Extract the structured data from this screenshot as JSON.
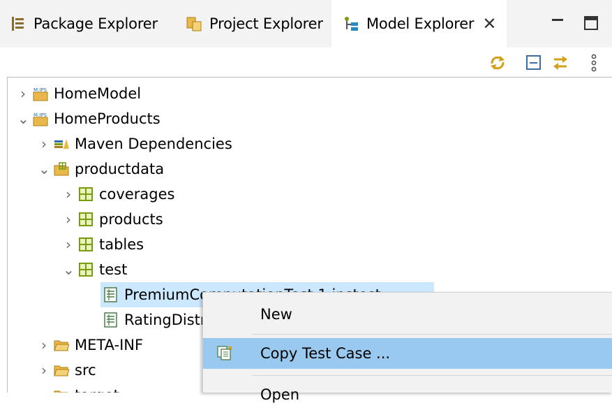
{
  "tabs": [
    {
      "label": "Package Explorer",
      "icon": "package-explorer-icon"
    },
    {
      "label": "Project Explorer",
      "icon": "project-explorer-icon"
    },
    {
      "label": "Model Explorer",
      "icon": "model-explorer-icon",
      "active": true,
      "close": "✕"
    }
  ],
  "window_controls": {
    "minimize": "minimize-icon",
    "maximize": "maximize-icon"
  },
  "toolbar_icons": [
    "sync-icon",
    "collapse-all-icon",
    "link-with-editor-icon",
    "view-menu-icon"
  ],
  "tree": [
    {
      "label": "HomeModel",
      "expanded": false,
      "icon": "model-project-icon"
    },
    {
      "label": "HomeProducts",
      "expanded": true,
      "icon": "model-project-icon"
    },
    {
      "label": "Maven Dependencies",
      "expanded": false,
      "icon": "library-icon"
    },
    {
      "label": "productdata",
      "expanded": true,
      "icon": "source-folder-icon"
    },
    {
      "label": "coverages",
      "expanded": false,
      "icon": "package-icon"
    },
    {
      "label": "products",
      "expanded": false,
      "icon": "package-icon"
    },
    {
      "label": "tables",
      "expanded": false,
      "icon": "package-icon"
    },
    {
      "label": "test",
      "expanded": true,
      "icon": "package-icon"
    },
    {
      "label": "PremiumComputationTest 1.ipstest",
      "icon": "test-case-icon",
      "selected": true
    },
    {
      "label": "RatingDistrictTest.ipstest",
      "icon": "test-case-icon"
    },
    {
      "label": "META-INF",
      "expanded": false,
      "icon": "folder-icon"
    },
    {
      "label": "src",
      "expanded": false,
      "icon": "folder-icon"
    },
    {
      "label": "target",
      "expanded": false,
      "icon": "folder-icon"
    }
  ],
  "context_menu": [
    {
      "label": "New"
    },
    {
      "label": "Copy Test Case ...",
      "icon": "copy-test-case-icon",
      "highlighted": true
    },
    {
      "label": "Open"
    }
  ],
  "colors": {
    "selection": "#cce8ff",
    "menu_highlight": "#99c9ef",
    "menu_bg": "#f2f2f2",
    "tabbar_bg": "#f3f3f3",
    "package_icon": "#7a9a10",
    "folder_icon": "#e8b84a"
  }
}
